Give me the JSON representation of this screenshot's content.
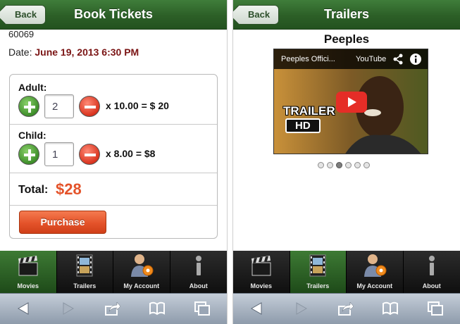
{
  "left": {
    "back_label": "Back",
    "title": "Book Tickets",
    "zip": "60069",
    "date_label": "Date:",
    "date_value": "June 19, 2013 6:30 PM",
    "adult": {
      "label": "Adult:",
      "quantity": "2",
      "calc": "x 10.00 = $ 20"
    },
    "child": {
      "label": "Child:",
      "quantity": "1",
      "calc": "x 8.00 = $8"
    },
    "total_label": "Total:",
    "total_value": "$28",
    "purchase_label": "Purchase"
  },
  "right": {
    "back_label": "Back",
    "title": "Trailers",
    "movie_title": "Peeples",
    "video": {
      "title": "Peeples Offici...",
      "source": "YouTube",
      "overlay_text": "TRAILER",
      "badge": "HD"
    },
    "pager": {
      "count": 6,
      "active_index": 2
    }
  },
  "tabbar_left": {
    "active": "Movies",
    "tabs": [
      {
        "label": "Movies",
        "icon": "clapperboard-icon"
      },
      {
        "label": "Trailers",
        "icon": "film-strip-icon"
      },
      {
        "label": "My Account",
        "icon": "user-gear-icon"
      },
      {
        "label": "About",
        "icon": "info-icon"
      }
    ]
  },
  "tabbar_right": {
    "active": "Trailers",
    "tabs": [
      {
        "label": "Movies",
        "icon": "clapperboard-icon"
      },
      {
        "label": "Trailers",
        "icon": "film-strip-icon"
      },
      {
        "label": "My Account",
        "icon": "user-gear-icon"
      },
      {
        "label": "About",
        "icon": "info-icon"
      }
    ]
  },
  "safari_toolbar": {
    "icons": [
      "back-arrow-icon",
      "forward-arrow-icon",
      "share-icon",
      "bookmarks-icon",
      "tabs-icon"
    ]
  },
  "colors": {
    "header_green": "#2c5f27",
    "accent_orange": "#e4532a",
    "date_red": "#7a1414"
  }
}
